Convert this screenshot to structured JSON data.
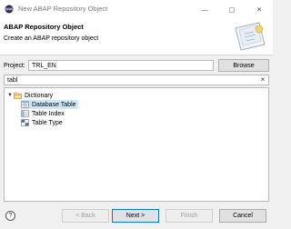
{
  "window": {
    "title": "New ABAP Repository Object",
    "minimize": "—",
    "maximize": "▢",
    "close": "✕",
    "icon": "eclipse-app-icon"
  },
  "banner": {
    "title": "ABAP Repository Object",
    "description": "Create an ABAP repository object",
    "graphic": "wizard-banner-graphic"
  },
  "project": {
    "label": "Project:",
    "value": "TRL_EN",
    "browse_label": "Browse"
  },
  "filter": {
    "value": "tabl",
    "clear": "×"
  },
  "tree": {
    "folder": {
      "label": "Dictionary",
      "expanded": true
    },
    "items": [
      {
        "label": "Database Table",
        "selected": true,
        "icon": "database-table-icon"
      },
      {
        "label": "Table Index",
        "selected": false,
        "icon": "table-index-icon"
      },
      {
        "label": "Table Type",
        "selected": false,
        "icon": "table-type-icon"
      }
    ]
  },
  "footer": {
    "help": "?",
    "back_label": "< Back",
    "next_label": "Next >",
    "finish_label": "Finish",
    "cancel_label": "Cancel"
  },
  "colors": {
    "selection": "#cce8ff",
    "default_button_border": "#0078d7",
    "folder": "#e8b84a"
  }
}
